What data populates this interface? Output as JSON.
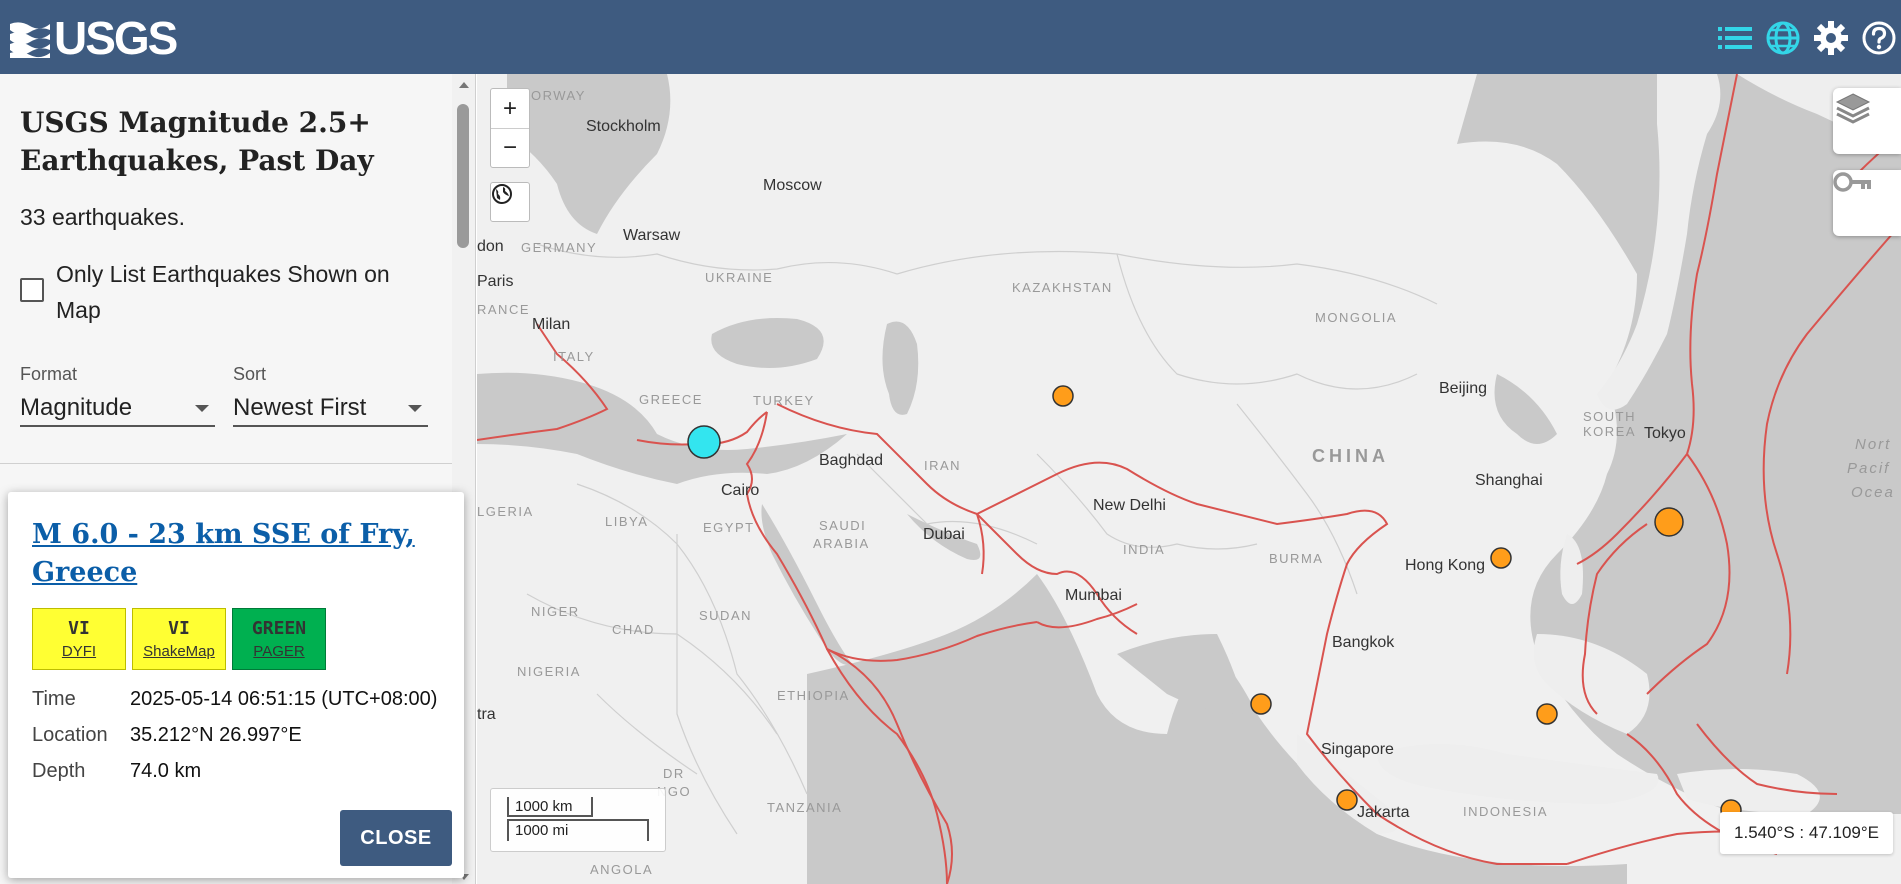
{
  "header": {
    "logo_text": "USGS",
    "icons": [
      "list-icon",
      "globe-icon",
      "gear-icon",
      "help-icon"
    ]
  },
  "sidebar": {
    "title": "USGS Magnitude 2.5+ Earthquakes, Past Day",
    "count": "33 earthquakes.",
    "checkbox_label": "Only List Earthquakes Shown on Map",
    "format_label": "Format",
    "format_value": "Magnitude",
    "sort_label": "Sort",
    "sort_value": "Newest First"
  },
  "popup": {
    "title": "M 6.0 - 23 km SSE of Fry, Greece",
    "badges": [
      {
        "value": "VI",
        "label": "DYFI",
        "color": "#ffff33"
      },
      {
        "value": "VI",
        "label": "ShakeMap",
        "color": "#ffff33"
      },
      {
        "value": "GREEN",
        "label": "PAGER",
        "color": "#00b050"
      }
    ],
    "time_label": "Time",
    "time_value": "2025-05-14 06:51:15 (UTC+08:00)",
    "location_label": "Location",
    "location_value": "35.212°N 26.997°E",
    "depth_label": "Depth",
    "depth_value": "74.0 km",
    "close_label": "CLOSE"
  },
  "map": {
    "zoom_in": "+",
    "zoom_out": "−",
    "scale_km": "1000 km",
    "scale_mi": "1000 mi",
    "coords": "1.540°S : 47.109°E",
    "cities": [
      "Stockholm",
      "Moscow",
      "Warsaw",
      "don",
      "Paris",
      "Milan",
      "Baghdad",
      "Cairo",
      "Dubai",
      "New Delhi",
      "Mumbai",
      "Beijing",
      "Tokyo",
      "Shanghai",
      "Hong Kong",
      "Bangkok",
      "Singapore",
      "Jakarta",
      "tra"
    ],
    "countries": [
      "ORWAY",
      "GERMANY",
      "UKRAINE",
      "KAZAKHSTAN",
      "MONGOLIA",
      "RANCE",
      "ITALY",
      "GREECE",
      "TURKEY",
      "IRAN",
      "SOUTH",
      "KOREA",
      "LGERIA",
      "LIBYA",
      "EGYPT",
      "SAUDI",
      "ARABIA",
      "INDIA",
      "BURMA",
      "NIGER",
      "CHAD",
      "SUDAN",
      "NIGERIA",
      "ETHIOPIA",
      "DR",
      "NGO",
      "TANZANIA",
      "ANGOLA",
      "INDONESIA"
    ],
    "china": "CHINA",
    "ocean": [
      "Nort",
      "Pacif",
      "Ocea"
    ],
    "highlight_color": "#33e5ef",
    "quake_color": "#ff9d1a",
    "plate_color": "#d9534f"
  }
}
